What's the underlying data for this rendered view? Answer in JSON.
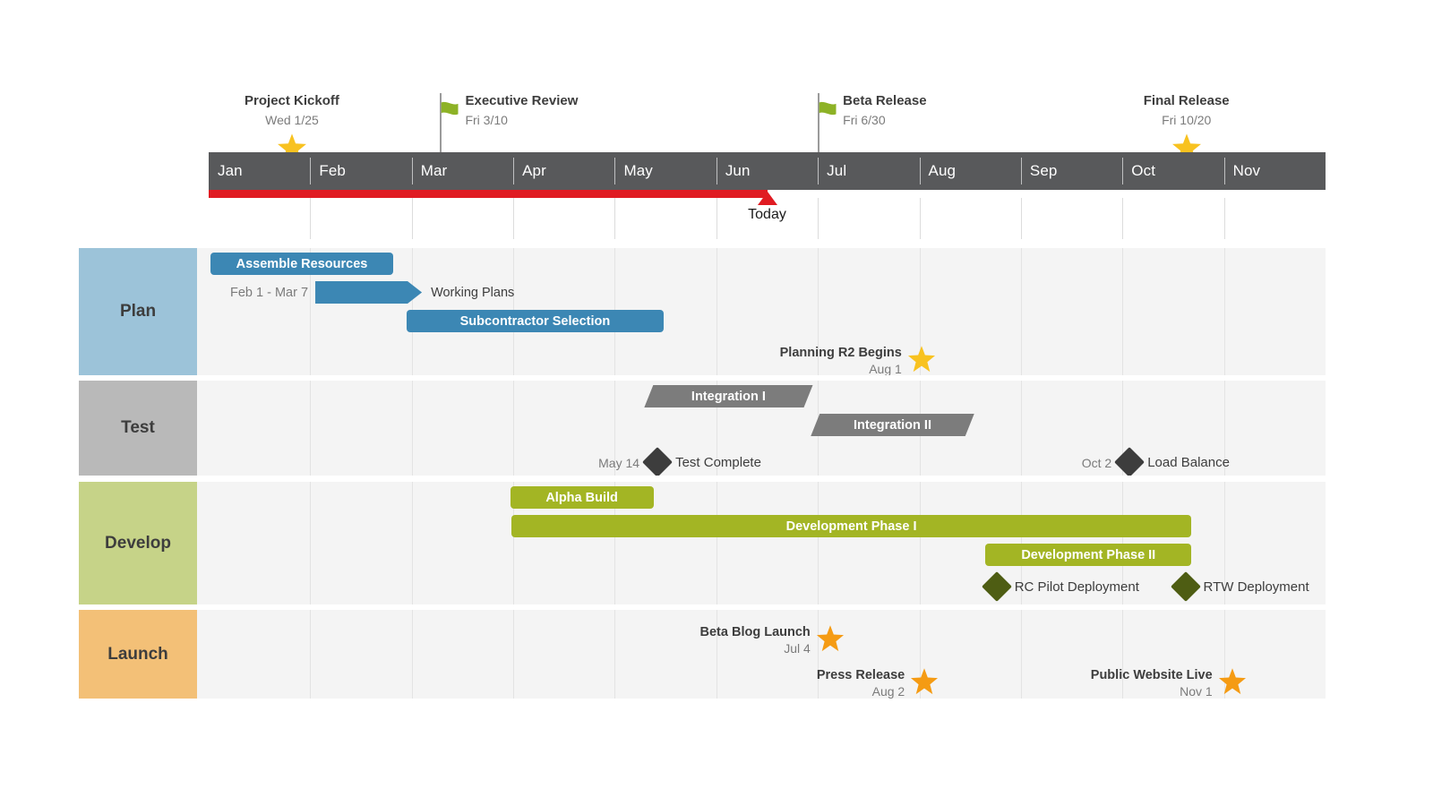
{
  "timeline": {
    "months": [
      "Jan",
      "Feb",
      "Mar",
      "Apr",
      "May",
      "Jun",
      "Jul",
      "Aug",
      "Sep",
      "Oct",
      "Nov"
    ],
    "header_color": "#58595B",
    "progress_color": "#E01B22",
    "progress_percent": 50,
    "today": {
      "label": "Today",
      "position_month_index": 5.5
    }
  },
  "top_milestones": [
    {
      "title": "Project Kickoff",
      "date": "Wed 1/25",
      "marker": "star-icon",
      "marker_color": "#F8C220",
      "month_pos": 0.82
    },
    {
      "title": "Executive Review",
      "date": "Fri 3/10",
      "marker": "flag-icon",
      "marker_color": "#8DB226",
      "month_pos": 2.28
    },
    {
      "title": "Beta Release",
      "date": "Fri 6/30",
      "marker": "flag-icon",
      "marker_color": "#8DB226",
      "month_pos": 6.0
    },
    {
      "title": "Final Release",
      "date": "Fri 10/20",
      "marker": "star-icon",
      "marker_color": "#F8C220",
      "month_pos": 9.63
    }
  ],
  "lanes": [
    {
      "name": "Plan",
      "color": "#9CC3D9",
      "bar_color": "#3C87B4",
      "bars": [
        {
          "label": "Assemble Resources",
          "shape": "rounded",
          "label_pos": "inside",
          "start": 0.015,
          "end": 1.82
        },
        {
          "label": "Working Plans",
          "shape": "arrow",
          "label_pos": "right",
          "side_label": "Feb 1 - Mar 7",
          "start": 1.05,
          "end": 2.1
        },
        {
          "label": "Subcontractor Selection",
          "shape": "rounded",
          "label_pos": "inside",
          "start": 1.95,
          "end": 4.48
        }
      ],
      "milestones": [
        {
          "title": "Planning R2 Begins",
          "date": "Aug 1",
          "marker": "star-icon",
          "marker_color": "#F8C220",
          "label_side": "left",
          "month_pos": 7.02
        }
      ]
    },
    {
      "name": "Test",
      "color": "#B9B9B9",
      "bar_color": "#7C7C7C",
      "bars": [
        {
          "label": "Integration I",
          "shape": "chamfer",
          "label_pos": "inside",
          "start": 4.29,
          "end": 5.95
        },
        {
          "label": "Integration II",
          "shape": "chamfer",
          "label_pos": "inside",
          "start": 5.93,
          "end": 7.54
        }
      ],
      "milestones": [
        {
          "title": "Test Complete",
          "date": "May 14",
          "marker": "diamond-icon",
          "marker_color": "#3D3D3D",
          "label_side": "right",
          "month_pos": 4.42
        },
        {
          "title": "Load Balance",
          "date": "Oct 2",
          "marker": "diamond-icon",
          "marker_color": "#3D3D3D",
          "label_side": "right",
          "month_pos": 9.07
        }
      ]
    },
    {
      "name": "Develop",
      "color": "#C6D388",
      "bar_color": "#A3B524",
      "bars": [
        {
          "label": "Alpha Build",
          "shape": "rounded",
          "label_pos": "inside",
          "start": 2.97,
          "end": 4.38
        },
        {
          "label": "Development Phase I",
          "shape": "rounded",
          "label_pos": "inside",
          "start": 2.98,
          "end": 9.68
        },
        {
          "label": "Development Phase II",
          "shape": "rounded",
          "label_pos": "inside",
          "start": 7.65,
          "end": 9.68
        }
      ],
      "milestones": [
        {
          "title": "RC Pilot Deployment",
          "date": "",
          "marker": "diamond-icon",
          "marker_color": "#4E5D13",
          "label_side": "right",
          "month_pos": 7.76
        },
        {
          "title": "RTW Deployment",
          "date": "",
          "marker": "diamond-icon",
          "marker_color": "#4E5D13",
          "label_side": "right",
          "month_pos": 9.62
        }
      ]
    },
    {
      "name": "Launch",
      "color": "#F3C077",
      "bar_color": "#F3C077",
      "bars": [],
      "milestones": [
        {
          "title": "Beta Blog Launch",
          "date": "Jul 4",
          "marker": "star-icon",
          "marker_color": "#F59B13",
          "label_side": "left",
          "month_pos": 6.12
        },
        {
          "title": "Press Release",
          "date": "Aug 2",
          "marker": "star-icon",
          "marker_color": "#F59B13",
          "label_side": "left",
          "month_pos": 7.05
        },
        {
          "title": "Public Website Live",
          "date": "Nov 1",
          "marker": "star-icon",
          "marker_color": "#F59B13",
          "label_side": "left",
          "month_pos": 10.08
        }
      ]
    }
  ]
}
